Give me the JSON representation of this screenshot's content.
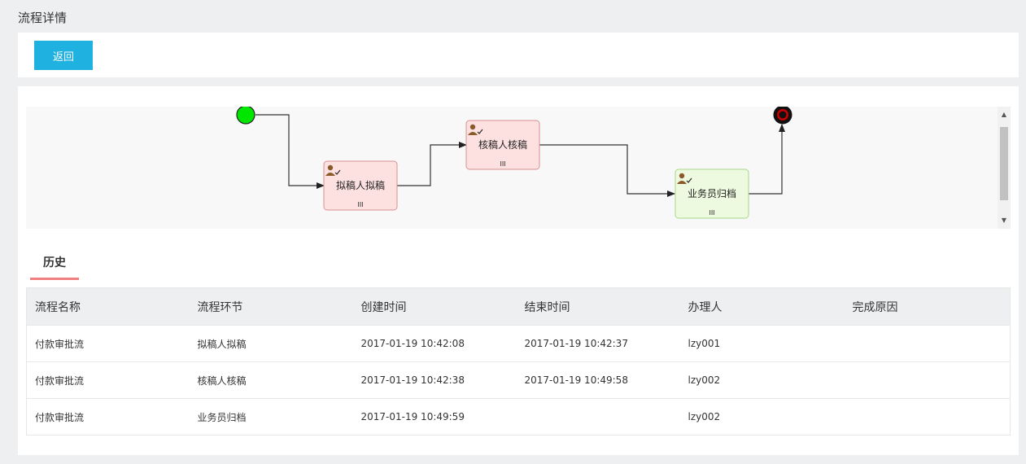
{
  "page": {
    "title": "流程详情"
  },
  "toolbar": {
    "back_label": "返回"
  },
  "diagram": {
    "nodes": [
      {
        "label": "拟稿人拟稿",
        "status": "completed"
      },
      {
        "label": "核稿人核稿",
        "status": "completed"
      },
      {
        "label": "业务员归档",
        "status": "active"
      }
    ],
    "marker": "III",
    "colors": {
      "start": "#00e600",
      "end_ring": "#cc0000",
      "completed_fill": "#fde1e1",
      "completed_stroke": "#d99090",
      "active_fill": "#eefadf",
      "active_stroke": "#a8d88a"
    }
  },
  "tabs": {
    "history_label": "历史"
  },
  "table": {
    "headers": [
      "流程名称",
      "流程环节",
      "创建时间",
      "结束时间",
      "办理人",
      "完成原因"
    ],
    "rows": [
      [
        "付款审批流",
        "拟稿人拟稿",
        "2017-01-19 10:42:08",
        "2017-01-19 10:42:37",
        "lzy001",
        ""
      ],
      [
        "付款审批流",
        "核稿人核稿",
        "2017-01-19 10:42:38",
        "2017-01-19 10:49:58",
        "lzy002",
        ""
      ],
      [
        "付款审批流",
        "业务员归档",
        "2017-01-19 10:49:59",
        "",
        "lzy002",
        ""
      ]
    ]
  }
}
